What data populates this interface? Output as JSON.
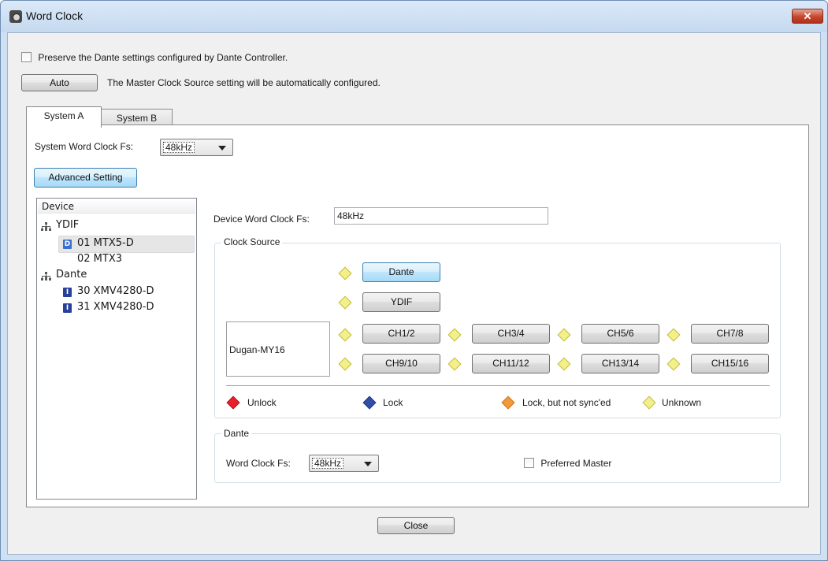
{
  "window": {
    "title": "Word Clock",
    "close_glyph": "✕"
  },
  "preserve": {
    "label": "Preserve the Dante settings configured by Dante Controller.",
    "checked": false
  },
  "auto": {
    "button": "Auto",
    "description": "The Master Clock Source setting will be automatically configured."
  },
  "tabs": [
    {
      "label": "System A",
      "active": true
    },
    {
      "label": "System B",
      "active": false
    }
  ],
  "system": {
    "fs_label": "System Word Clock Fs:",
    "fs_value": "48kHz"
  },
  "advanced_button": "Advanced Setting",
  "tree": {
    "header": "Device",
    "groups": [
      {
        "label": "YDIF",
        "icon": "network-icon"
      },
      {
        "label": "Dante",
        "icon": "network-icon"
      }
    ],
    "items": [
      {
        "label": "01 MTX5-D",
        "badge": "D",
        "badge_color": "#3d6fd1",
        "selected": true
      },
      {
        "label": "02 MTX3",
        "badge": "",
        "selected": false
      },
      {
        "label": "30 XMV4280-D",
        "badge": "I",
        "badge_color": "#27409a",
        "selected": false
      },
      {
        "label": "31 XMV4280-D",
        "badge": "I",
        "badge_color": "#27409a",
        "selected": false
      }
    ]
  },
  "device": {
    "fs_label": "Device Word Clock Fs:",
    "fs_value": "48kHz"
  },
  "clock_source": {
    "title": "Clock Source",
    "dante_button": "Dante",
    "ydif_button": "YDIF",
    "slot_name": "Dugan-MY16",
    "channels_row1": [
      "CH1/2",
      "CH3/4",
      "CH5/6",
      "CH7/8"
    ],
    "channels_row2": [
      "CH9/10",
      "CH11/12",
      "CH13/14",
      "CH15/16"
    ]
  },
  "legend": {
    "unlock": "Unlock",
    "lock": "Lock",
    "lock_not_synced": "Lock, but not sync'ed",
    "unknown": "Unknown",
    "colors": {
      "unlock": "#e8202a",
      "lock": "#2f4ea8",
      "not_synced": "#f29a3a",
      "unknown": "#f3f08a"
    }
  },
  "dante": {
    "title": "Dante",
    "fs_label": "Word Clock Fs:",
    "fs_value": "48kHz",
    "preferred_master_label": "Preferred Master",
    "preferred_master_checked": false
  },
  "footer": {
    "close_button": "Close"
  }
}
